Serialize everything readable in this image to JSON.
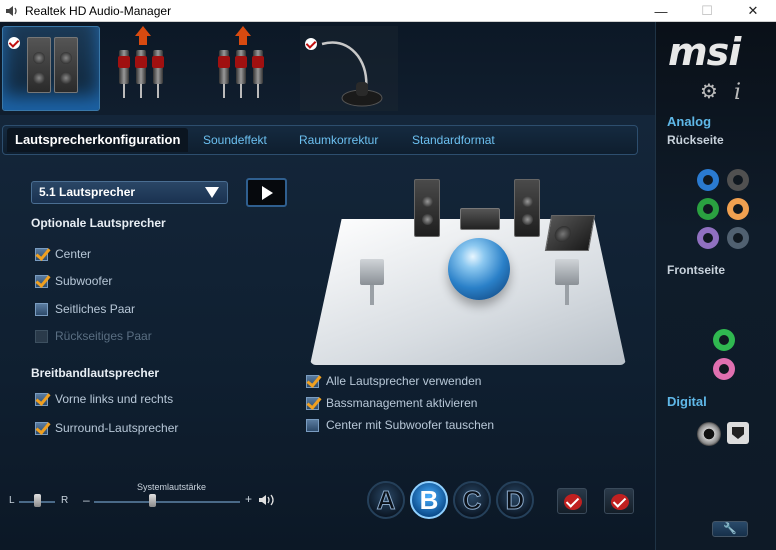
{
  "window": {
    "title": "Realtek HD Audio-Manager",
    "minimize": "—",
    "maximize": "☐",
    "close": "✕"
  },
  "tabs": [
    {
      "label": "Lautsprecherkonfiguration",
      "active": true
    },
    {
      "label": "Soundeffekt",
      "active": false
    },
    {
      "label": "Raumkorrektur",
      "active": false
    },
    {
      "label": "Standardformat",
      "active": false
    }
  ],
  "config": {
    "selected": "5.1 Lautsprecher",
    "optional_heading": "Optionale Lautsprecher",
    "optional": [
      {
        "label": "Center",
        "checked": true,
        "enabled": true
      },
      {
        "label": "Subwoofer",
        "checked": true,
        "enabled": true
      },
      {
        "label": "Seitliches Paar",
        "checked": false,
        "enabled": true
      },
      {
        "label": "Rückseitiges Paar",
        "checked": false,
        "enabled": false
      }
    ],
    "fullrange_heading": "Breitbandlautsprecher",
    "fullrange": [
      {
        "label": "Vorne links und rechts",
        "checked": true
      },
      {
        "label": "Surround-Lautsprecher",
        "checked": true
      }
    ],
    "stage_options": [
      {
        "label": "Alle Lautsprecher verwenden",
        "checked": true
      },
      {
        "label": "Bassmanagement aktivieren",
        "checked": true
      },
      {
        "label": "Center mit Subwoofer tauschen",
        "checked": false
      }
    ]
  },
  "volume": {
    "title": "Systemlautstärke",
    "balance_left": "L",
    "balance_right": "R",
    "minus": "–",
    "plus": "+",
    "balance_level": 0.5,
    "volume_level": 0.4
  },
  "profiles": [
    "A",
    "B",
    "C",
    "D"
  ],
  "active_profile": "B",
  "sidebar": {
    "brand": "msi",
    "analog": "Analog",
    "rear": "Rückseite",
    "front": "Frontseite",
    "digital": "Digital",
    "rear_jacks": [
      "#2a7ad0",
      "#505050",
      "#2aa040",
      "#f0a050",
      "#9070c0",
      "#506070"
    ],
    "front_jacks": [
      "#30b850",
      "#e070b0"
    ]
  },
  "icons": {
    "settings": "gear-icon",
    "info": "info-icon",
    "wrench": "wrench-icon"
  }
}
